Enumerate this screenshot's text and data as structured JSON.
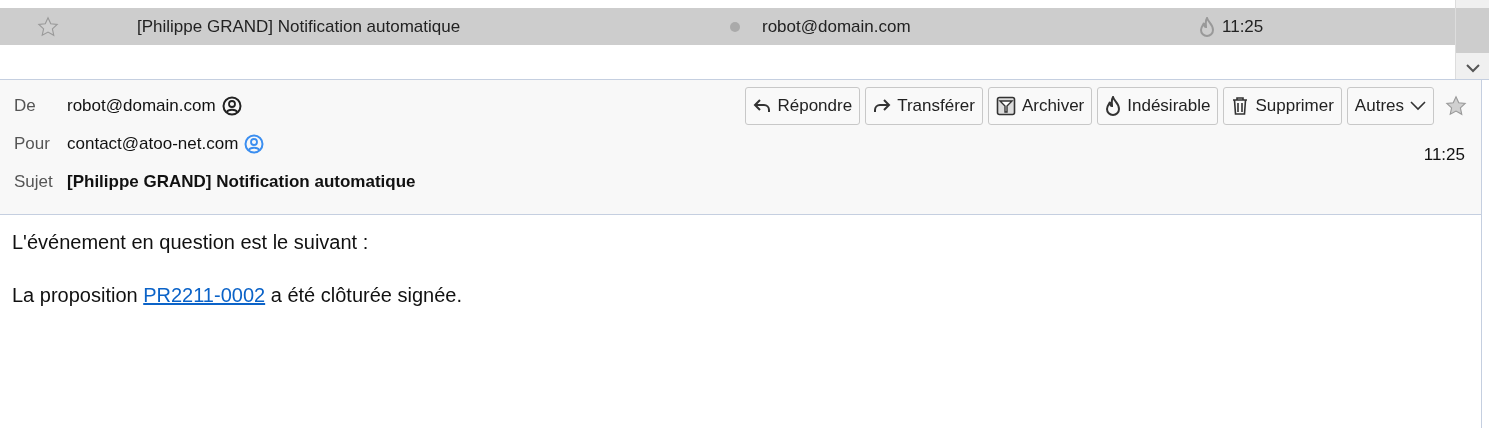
{
  "message_list": {
    "rows": [
      {
        "starred": false,
        "selected": true,
        "subject": "[Philippe GRAND] Notification automatique",
        "read": true,
        "from": "robot@domain.com",
        "junk": true,
        "time": "11:25"
      }
    ]
  },
  "header": {
    "fields": [
      {
        "label": "De",
        "value": "robot@domain.com",
        "kind": "from"
      },
      {
        "label": "Pour",
        "value": "contact@atoo-net.com",
        "kind": "to"
      },
      {
        "label": "Sujet",
        "value": "[Philippe GRAND] Notification automatique",
        "kind": "subject"
      }
    ],
    "buttons": [
      {
        "label": "Répondre",
        "kind": "reply"
      },
      {
        "label": "Transférer",
        "kind": "forward"
      },
      {
        "label": "Archiver",
        "kind": "archive"
      },
      {
        "label": "Indésirable",
        "kind": "junk"
      },
      {
        "label": "Supprimer",
        "kind": "delete"
      },
      {
        "label": "Autres",
        "kind": "more"
      }
    ],
    "starred": false,
    "time": "11:25"
  },
  "body": {
    "paragraphs": [
      {
        "parts": [
          {
            "text": "L'événement en question est le suivant :"
          }
        ]
      },
      {
        "parts": [
          {
            "text": "La proposition "
          },
          {
            "text": "PR2211-0002",
            "link": true
          },
          {
            "text": " a été clôturée signée."
          }
        ]
      }
    ]
  }
}
